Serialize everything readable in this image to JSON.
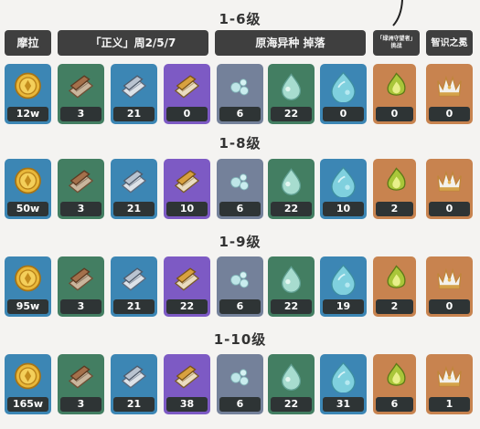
{
  "header": {
    "col_mora": "摩拉",
    "col_justice": "「正义」周2/5/7",
    "col_drops": "原海异种 掉落",
    "col_guardian": "「绿洲守望者」挑战",
    "col_crown": "智识之冕"
  },
  "rows": [
    {
      "title": "1-6级",
      "values": [
        "12w",
        "3",
        "21",
        "0",
        "6",
        "22",
        "0",
        "0",
        "0"
      ]
    },
    {
      "title": "1-8级",
      "values": [
        "50w",
        "3",
        "21",
        "10",
        "6",
        "22",
        "10",
        "2",
        "0"
      ]
    },
    {
      "title": "1-9级",
      "values": [
        "95w",
        "3",
        "21",
        "22",
        "6",
        "22",
        "19",
        "2",
        "0"
      ]
    },
    {
      "title": "1-10级",
      "values": [
        "165w",
        "3",
        "21",
        "38",
        "6",
        "22",
        "31",
        "6",
        "1"
      ]
    }
  ],
  "items": [
    {
      "name": "mora-coin-icon",
      "color": "#3c86b4"
    },
    {
      "name": "teachings-justice-icon",
      "color": "#437e62"
    },
    {
      "name": "guide-justice-icon",
      "color": "#3c86b4"
    },
    {
      "name": "philosophies-justice-icon",
      "color": "#7d5ac4"
    },
    {
      "name": "small-water-drop-icon",
      "color": "#74819a"
    },
    {
      "name": "medium-water-drop-icon",
      "color": "#437e62"
    },
    {
      "name": "large-water-drop-icon",
      "color": "#3c86b4"
    },
    {
      "name": "green-flame-icon",
      "color": "#c8834f"
    },
    {
      "name": "crown-of-insight-icon",
      "color": "#c8834f"
    }
  ]
}
